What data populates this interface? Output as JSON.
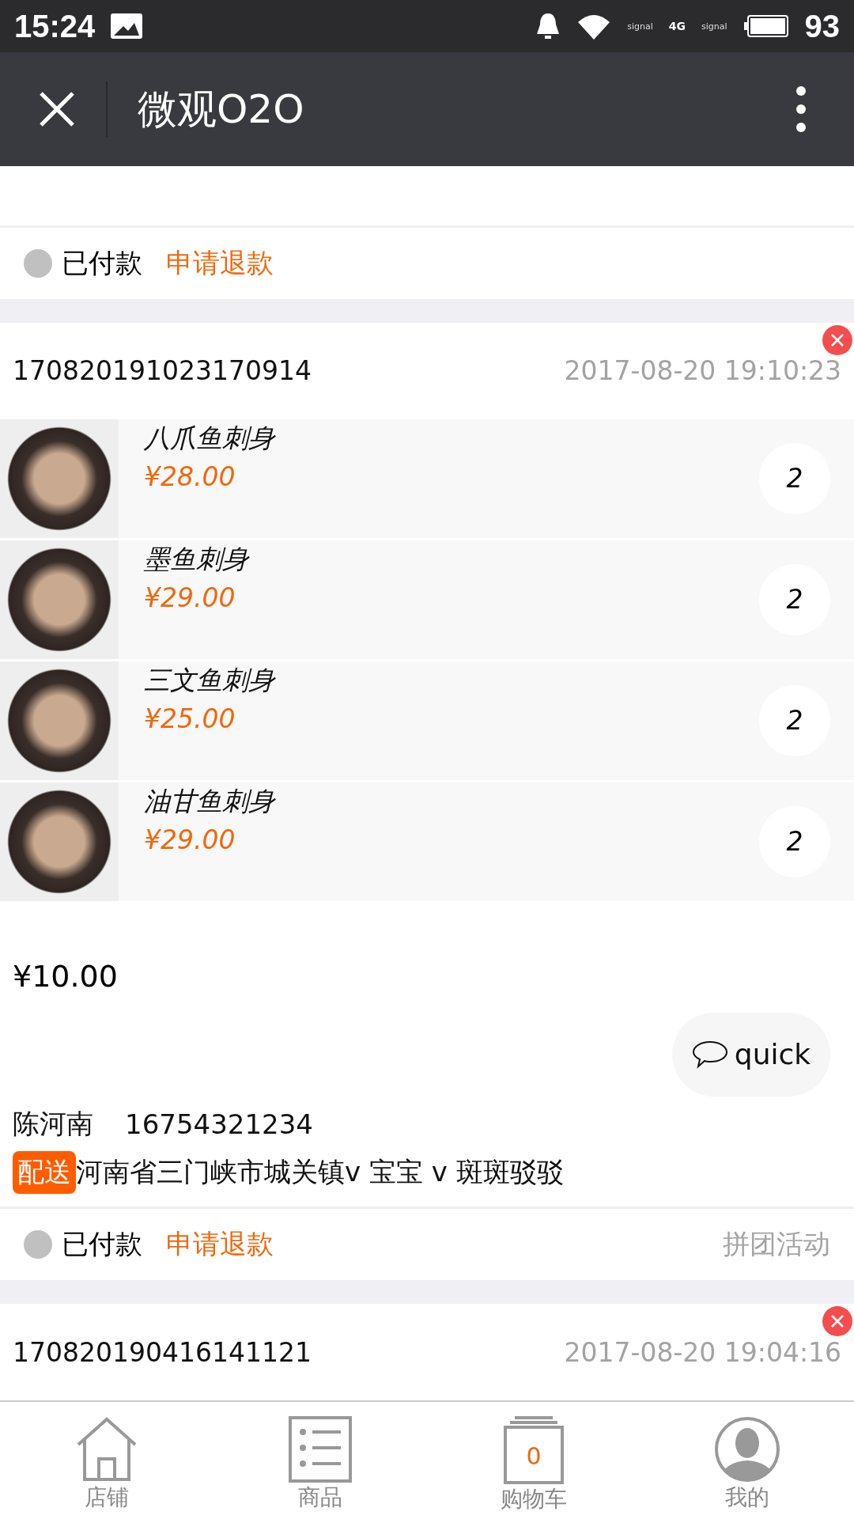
{
  "status_bar": {
    "time": "15:24",
    "signal_label_1": "signal",
    "network": "4G",
    "signal_label_2": "signal",
    "battery": "93"
  },
  "header": {
    "title": "微观O2O"
  },
  "orders": [
    {
      "kind": "tail",
      "status": "已付款",
      "refund": "申请退款"
    },
    {
      "kind": "full",
      "number": "170820191023170914",
      "time": "2017-08-20 19:10:23",
      "items": [
        {
          "name": "八爪鱼刺身",
          "price": "¥28.00",
          "count": "2"
        },
        {
          "name": "墨鱼刺身",
          "price": "¥29.00",
          "count": "2"
        },
        {
          "name": "三文鱼刺身",
          "price": "¥25.00",
          "count": "2"
        },
        {
          "name": "油甘鱼刺身",
          "price": "¥29.00",
          "count": "2"
        }
      ],
      "total": "¥10.00",
      "quick": "quick",
      "contact": "陈河南",
      "phone": "16754321234",
      "delivery_tag": "配送",
      "address": "河南省三门峡市城关镇v 宝宝 v 斑斑驳驳",
      "status": "已付款",
      "refund": "申请退款",
      "activity": "拼团活动"
    },
    {
      "kind": "head",
      "number": "170820190416141121",
      "time": "2017-08-20 19:04:16"
    }
  ],
  "nav": [
    {
      "label": "店铺",
      "kind": "house"
    },
    {
      "label": "商品",
      "kind": "list"
    },
    {
      "label": "购物车",
      "kind": "cart",
      "badge": "0"
    },
    {
      "label": "我的",
      "kind": "person"
    }
  ]
}
